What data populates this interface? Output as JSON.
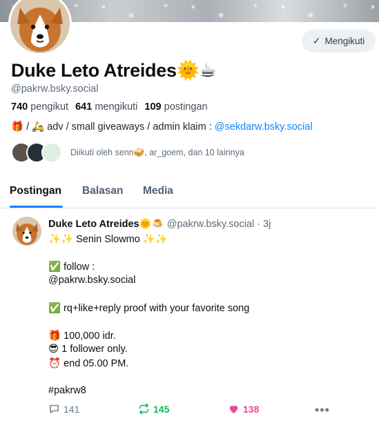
{
  "colors": {
    "accent": "#1083fe",
    "repost": "#13b25a",
    "like": "#ec4899",
    "muted": "#5b6b7b"
  },
  "profile": {
    "name": "Duke Leto Atreides🌞☕",
    "handle": "@pakrw.bsky.social",
    "follow_button": "Mengikuti",
    "stats": {
      "followers_count": "740",
      "followers_label": "pengikut",
      "following_count": "641",
      "following_label": "mengikuti",
      "posts_count": "109",
      "posts_label": "postingan"
    },
    "bio_prefix": "🎁 / 🛵 adv / small giveaways / admin klaim : ",
    "bio_link": "@sekdarw.bsky.social",
    "followed_by": "Diikuti oleh senn🥪, ar_goem, dan 10 lainnya"
  },
  "tabs": [
    "Postingan",
    "Balasan",
    "Media"
  ],
  "post": {
    "author": "Duke Leto Atreides🌞🍮",
    "meta": "@pakrw.bsky.social · 3j",
    "lines": {
      "l1": "✨✨ Senin Slowmo ✨✨",
      "l2": "✅ follow :",
      "l3": "@pakrw.bsky.social",
      "l4": "✅ rq+like+reply proof with your favorite song",
      "l5": "🎁 100,000 idr.",
      "l6": "😎 1 follower only.",
      "l7": "⏰  end 05.00 PM.",
      "l8": "#pakrw8"
    },
    "replies": "141",
    "reposts": "145",
    "likes": "138",
    "more": "•••"
  },
  "icons": [
    "check-icon",
    "reply-icon",
    "repost-icon",
    "heart-icon",
    "more-icon"
  ]
}
